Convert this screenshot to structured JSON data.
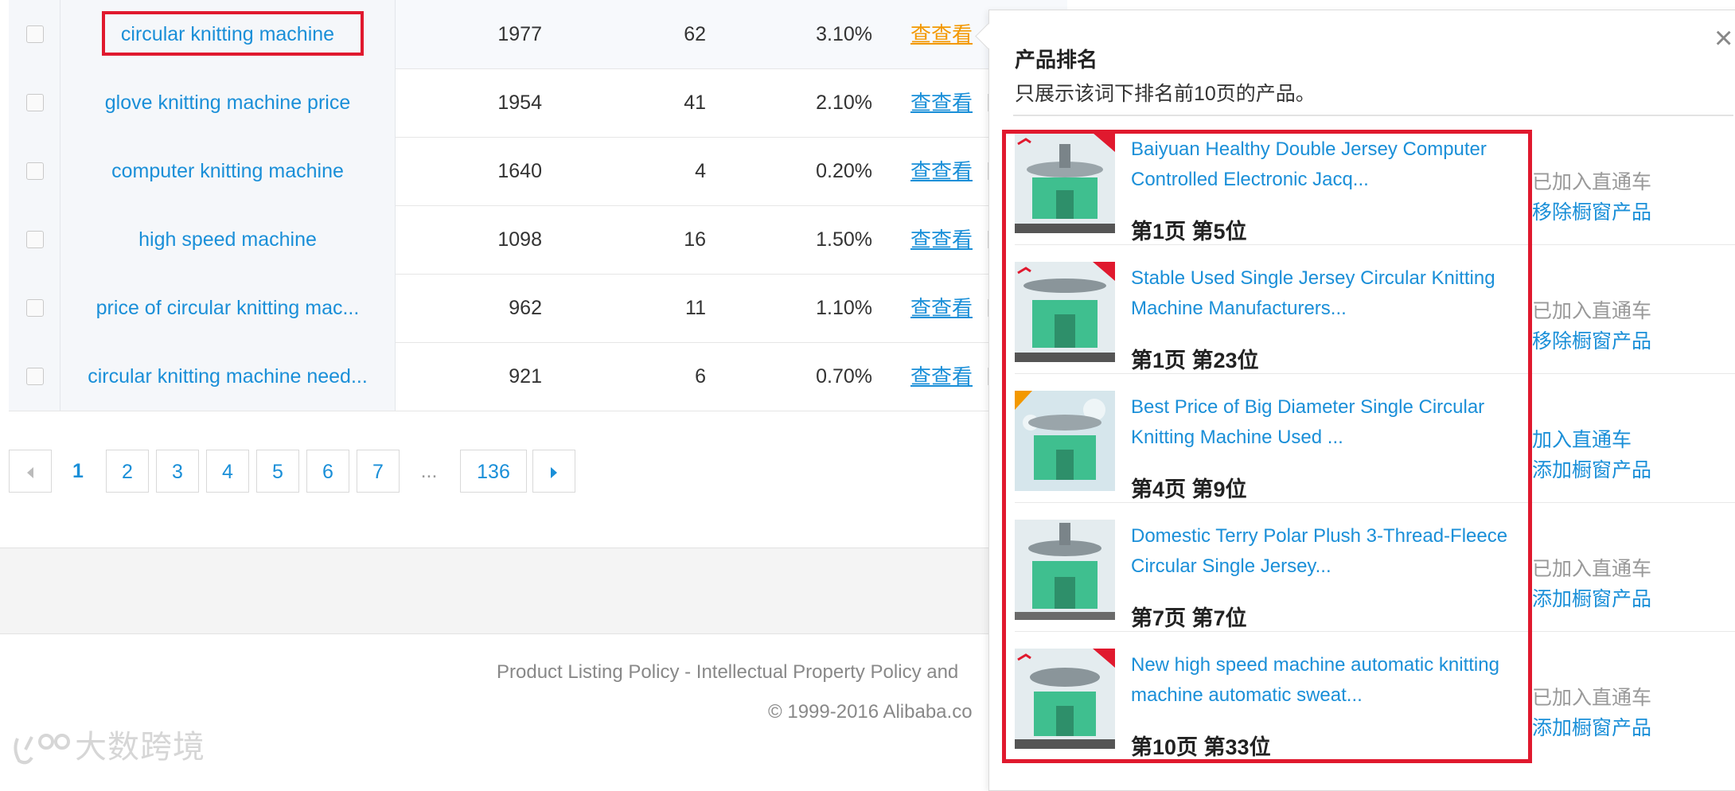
{
  "table": {
    "rows": [
      {
        "keyword": "circular knitting machine",
        "v1": "1977",
        "v2": "62",
        "v3": "3.10%",
        "view": "查查看",
        "active": true
      },
      {
        "keyword": "glove knitting machine price",
        "v1": "1954",
        "v2": "41",
        "v3": "2.10%",
        "view": "查查看",
        "active": false
      },
      {
        "keyword": "computer knitting machine",
        "v1": "1640",
        "v2": "4",
        "v3": "0.20%",
        "view": "查查看",
        "active": false
      },
      {
        "keyword": "high speed machine",
        "v1": "1098",
        "v2": "16",
        "v3": "1.50%",
        "view": "查查看",
        "active": false
      },
      {
        "keyword": "price of circular knitting mac...",
        "v1": "962",
        "v2": "11",
        "v3": "1.10%",
        "view": "查查看",
        "active": false
      },
      {
        "keyword": "circular knitting machine need...",
        "v1": "921",
        "v2": "6",
        "v3": "0.70%",
        "view": "查查看",
        "active": false
      }
    ]
  },
  "pagination": {
    "current": "1",
    "pages": [
      "2",
      "3",
      "4",
      "5",
      "6",
      "7"
    ],
    "ellipsis": "...",
    "last": "136"
  },
  "footer": {
    "links": "Product Listing Policy - Intellectual Property Policy and",
    "copyright": "© 1999-2016 Alibaba.co"
  },
  "watermark": "大数跨境",
  "popup": {
    "title": "产品排名",
    "subtitle": "只展示该词下排名前10页的产品。",
    "close": "×",
    "products": [
      {
        "title": "Baiyuan Healthy Double Jersey Computer Controlled Electronic Jacq...",
        "rank": "第1页 第5位",
        "status": "已加入直通车",
        "action": "移除橱窗产品",
        "status_link": false
      },
      {
        "title": "Stable Used Single Jersey Circular Knitting Machine Manufacturers...",
        "rank": "第1页 第23位",
        "status": "已加入直通车",
        "action": "移除橱窗产品",
        "status_link": false
      },
      {
        "title": "Best Price of Big Diameter Single Circular Knitting Machine Used ...",
        "rank": "第4页 第9位",
        "status": "加入直通车",
        "action": "添加橱窗产品",
        "status_link": true
      },
      {
        "title": "Domestic Terry Polar Plush 3-Thread-Fleece Circular Single Jersey...",
        "rank": "第7页 第7位",
        "status": "已加入直通车",
        "action": "添加橱窗产品",
        "status_link": false
      },
      {
        "title": "New high speed machine automatic knitting machine automatic sweat...",
        "rank": "第10页 第33位",
        "status": "已加入直通车",
        "action": "添加橱窗产品",
        "status_link": false
      }
    ]
  },
  "colors": {
    "link": "#1a8fd8",
    "highlight": "#e0192e",
    "active_view": "#f39800"
  }
}
